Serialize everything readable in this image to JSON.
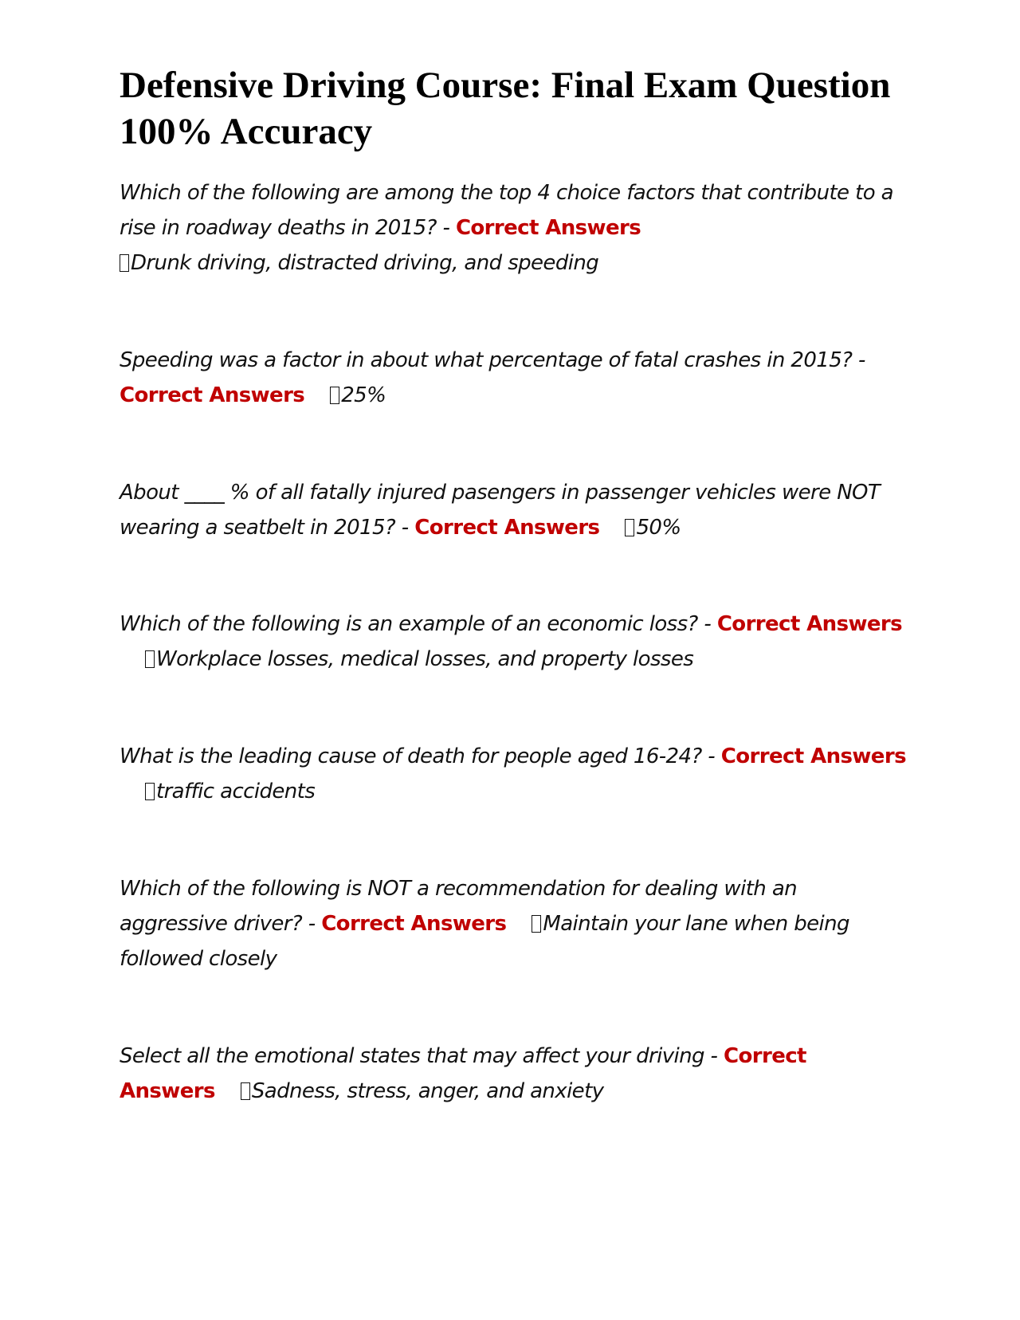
{
  "title": "Defensive Driving Course: Final Exam Question 100% Accuracy",
  "correct_label": "Correct Answers",
  "questions": [
    {
      "question": "Which of the following are among the top 4 choice factors that contribute to a rise in roadway deaths in 2015? - ",
      "answer": "Drunk driving, distracted driving, and speeding"
    },
    {
      "question": "Speeding was a factor in about what percentage of fatal crashes in 2015? - ",
      "answer": "25%"
    },
    {
      "question": "About ____ % of all fatally injured pasengers in passenger vehicles were NOT wearing a seatbelt in 2015? - ",
      "answer": "50%"
    },
    {
      "question": "Which of the following is an example of an economic loss? - ",
      "answer": "Workplace losses, medical losses, and property losses"
    },
    {
      "question": "What is the leading cause of death for people aged 16-24? - ",
      "answer": "traffic accidents"
    },
    {
      "question": "Which of the following is NOT a recommendation for dealing with an aggressive driver? - ",
      "answer": "Maintain your lane when being followed closely"
    },
    {
      "question": "Select all the emotional states that may affect your driving - ",
      "answer": "Sadness, stress, anger, and anxiety"
    }
  ]
}
